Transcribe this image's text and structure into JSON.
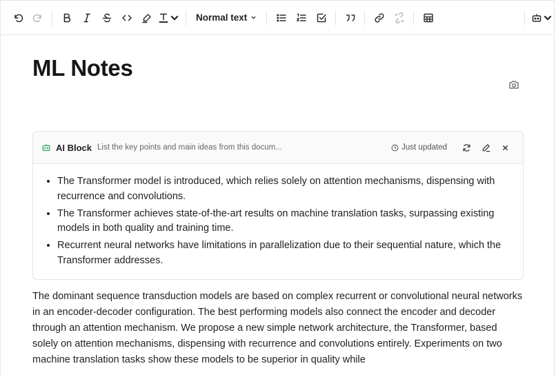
{
  "toolbar": {
    "text_style": "Normal text"
  },
  "document": {
    "title": "ML Notes"
  },
  "ai_block": {
    "label": "AI Block",
    "prompt": "List the key points and main ideas from this docum...",
    "status": "Just updated",
    "points": [
      "The Transformer model is introduced, which relies solely on attention mechanisms, dispensing with recurrence and convolutions.",
      "The Transformer achieves state-of-the-art results on machine translation tasks, surpassing existing models in both quality and training time.",
      "Recurrent neural networks have limitations in parallelization due to their sequential nature, which the Transformer addresses."
    ]
  },
  "body": {
    "paragraph": "The dominant sequence transduction models are based on complex recurrent or convolutional neural networks in an encoder-decoder configuration. The best performing models also connect the encoder and decoder through an attention mechanism. We propose a new simple network architecture, the Transformer, based solely on attention mechanisms, dispensing with recurrence and convolutions entirely. Experiments on two machine translation tasks show these models to be superior in quality while"
  }
}
